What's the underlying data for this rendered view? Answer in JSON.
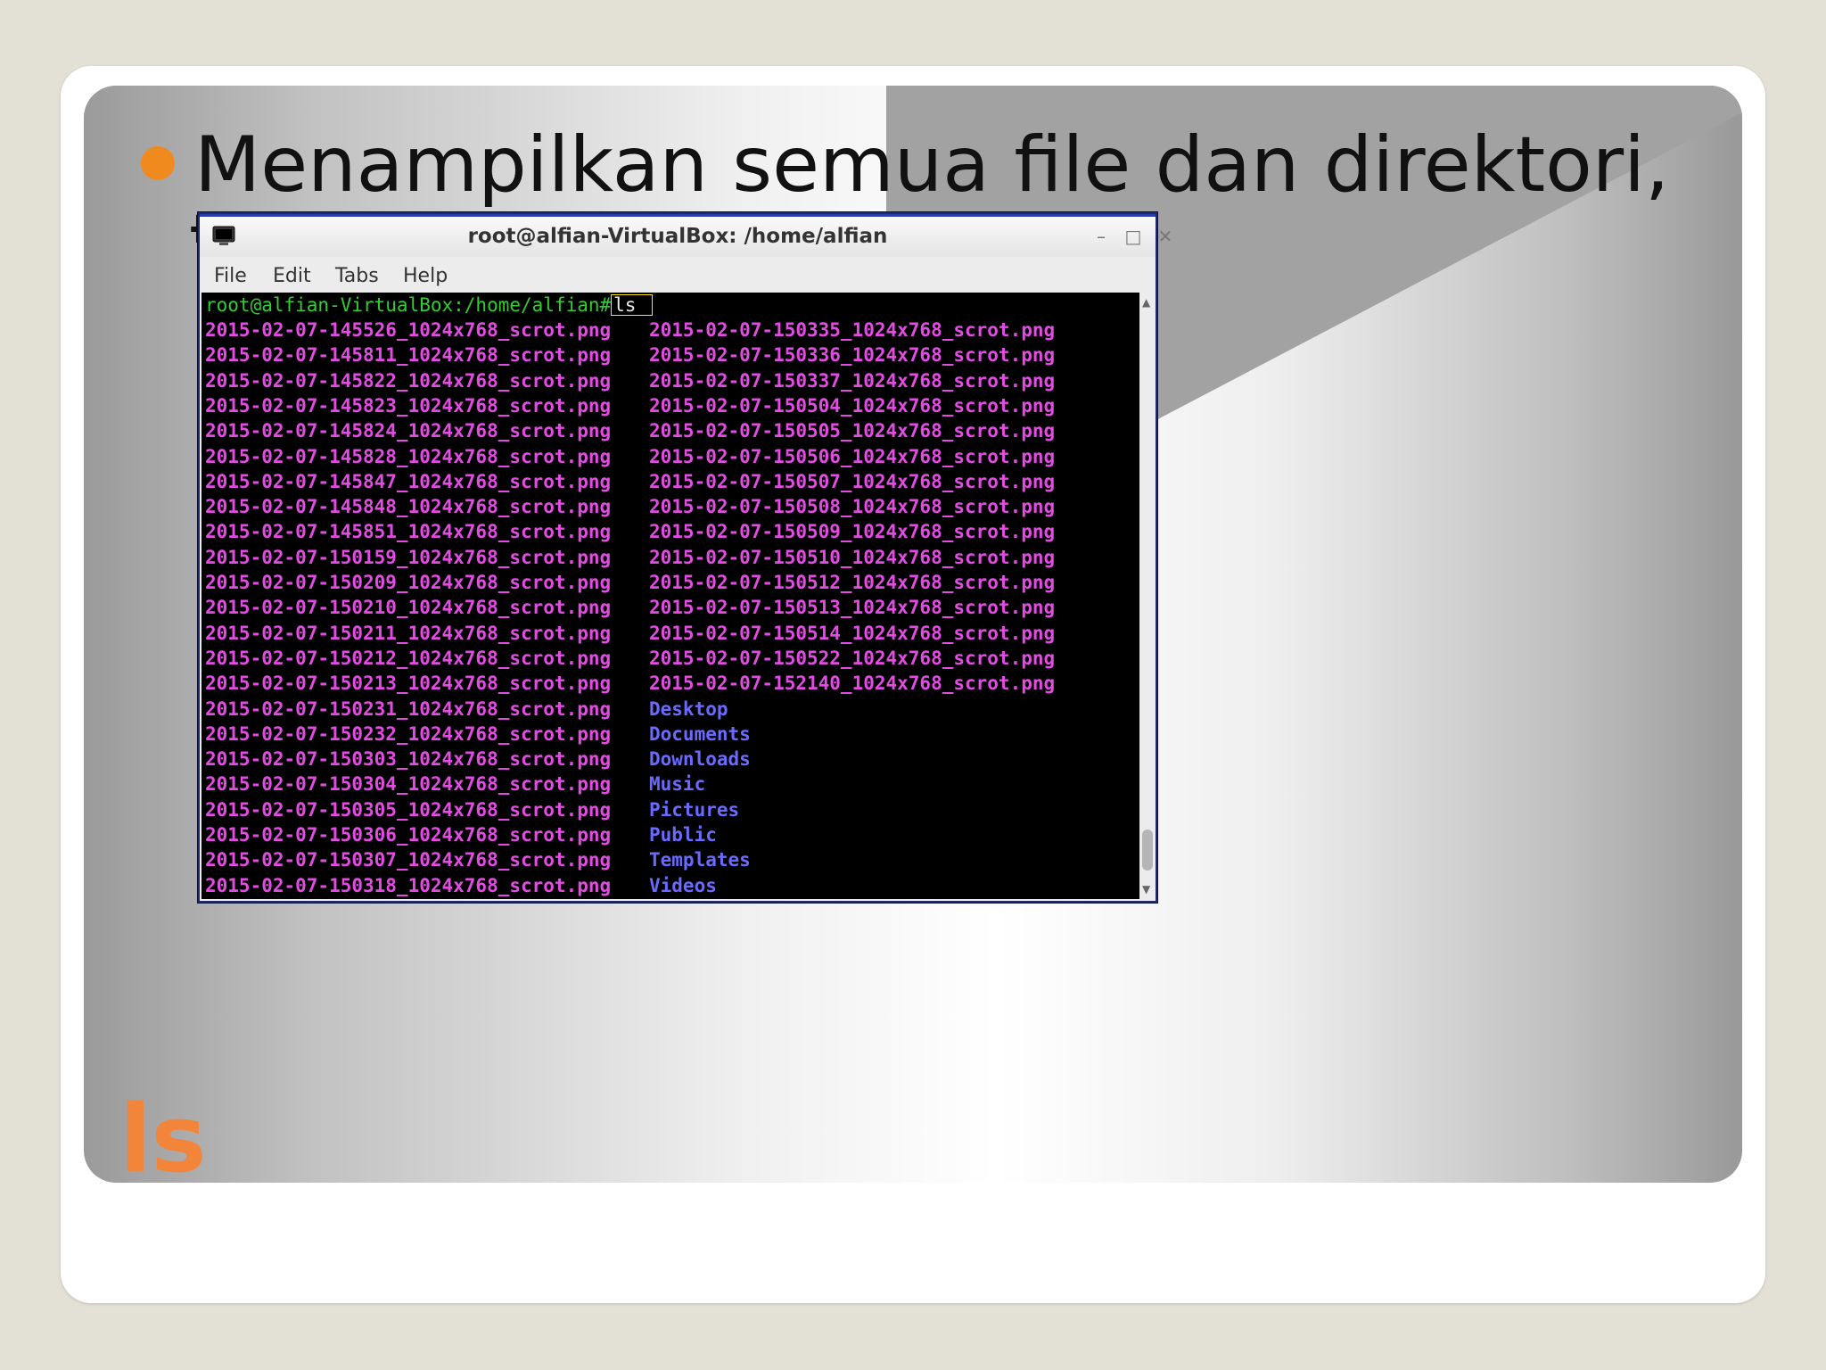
{
  "slide": {
    "bullet_text": "Menampilkan semua file dan direktori,",
    "bullet_text_line2": "t",
    "title": "ls",
    "colors": {
      "accent": "#f08a1e",
      "title": "#f3853a",
      "stage_gray": "#a0a0a0"
    }
  },
  "window": {
    "title": "root@alfian-VirtualBox: /home/alfian",
    "app_icon": "terminal-icon",
    "buttons": [
      "minimize-icon",
      "maximize-icon",
      "close-icon"
    ],
    "menu": [
      "File",
      "Edit",
      "Tabs",
      "Help"
    ]
  },
  "terminal": {
    "prompt": "root@alfian-VirtualBox:/home/alfian#",
    "command": "ls",
    "colors": {
      "prompt": "#33cc33",
      "file": "#e24ce2",
      "dir": "#6a6aff",
      "bg": "#000000"
    },
    "rows": [
      {
        "c1": "2015-02-07-145526_1024x768_scrot.png",
        "c2": "2015-02-07-150335_1024x768_scrot.png",
        "c2_type": "file"
      },
      {
        "c1": "2015-02-07-145811_1024x768_scrot.png",
        "c2": "2015-02-07-150336_1024x768_scrot.png",
        "c2_type": "file"
      },
      {
        "c1": "2015-02-07-145822_1024x768_scrot.png",
        "c2": "2015-02-07-150337_1024x768_scrot.png",
        "c2_type": "file"
      },
      {
        "c1": "2015-02-07-145823_1024x768_scrot.png",
        "c2": "2015-02-07-150504_1024x768_scrot.png",
        "c2_type": "file"
      },
      {
        "c1": "2015-02-07-145824_1024x768_scrot.png",
        "c2": "2015-02-07-150505_1024x768_scrot.png",
        "c2_type": "file"
      },
      {
        "c1": "2015-02-07-145828_1024x768_scrot.png",
        "c2": "2015-02-07-150506_1024x768_scrot.png",
        "c2_type": "file"
      },
      {
        "c1": "2015-02-07-145847_1024x768_scrot.png",
        "c2": "2015-02-07-150507_1024x768_scrot.png",
        "c2_type": "file"
      },
      {
        "c1": "2015-02-07-145848_1024x768_scrot.png",
        "c2": "2015-02-07-150508_1024x768_scrot.png",
        "c2_type": "file"
      },
      {
        "c1": "2015-02-07-145851_1024x768_scrot.png",
        "c2": "2015-02-07-150509_1024x768_scrot.png",
        "c2_type": "file"
      },
      {
        "c1": "2015-02-07-150159_1024x768_scrot.png",
        "c2": "2015-02-07-150510_1024x768_scrot.png",
        "c2_type": "file"
      },
      {
        "c1": "2015-02-07-150209_1024x768_scrot.png",
        "c2": "2015-02-07-150512_1024x768_scrot.png",
        "c2_type": "file"
      },
      {
        "c1": "2015-02-07-150210_1024x768_scrot.png",
        "c2": "2015-02-07-150513_1024x768_scrot.png",
        "c2_type": "file"
      },
      {
        "c1": "2015-02-07-150211_1024x768_scrot.png",
        "c2": "2015-02-07-150514_1024x768_scrot.png",
        "c2_type": "file"
      },
      {
        "c1": "2015-02-07-150212_1024x768_scrot.png",
        "c2": "2015-02-07-150522_1024x768_scrot.png",
        "c2_type": "file"
      },
      {
        "c1": "2015-02-07-150213_1024x768_scrot.png",
        "c2": "2015-02-07-152140_1024x768_scrot.png",
        "c2_type": "file"
      },
      {
        "c1": "2015-02-07-150231_1024x768_scrot.png",
        "c2": "Desktop",
        "c2_type": "dir"
      },
      {
        "c1": "2015-02-07-150232_1024x768_scrot.png",
        "c2": "Documents",
        "c2_type": "dir"
      },
      {
        "c1": "2015-02-07-150303_1024x768_scrot.png",
        "c2": "Downloads",
        "c2_type": "dir"
      },
      {
        "c1": "2015-02-07-150304_1024x768_scrot.png",
        "c2": "Music",
        "c2_type": "dir"
      },
      {
        "c1": "2015-02-07-150305_1024x768_scrot.png",
        "c2": "Pictures",
        "c2_type": "dir"
      },
      {
        "c1": "2015-02-07-150306_1024x768_scrot.png",
        "c2": "Public",
        "c2_type": "dir"
      },
      {
        "c1": "2015-02-07-150307_1024x768_scrot.png",
        "c2": "Templates",
        "c2_type": "dir"
      },
      {
        "c1": "2015-02-07-150318_1024x768_scrot.png",
        "c2": "Videos",
        "c2_type": "dir"
      }
    ]
  }
}
